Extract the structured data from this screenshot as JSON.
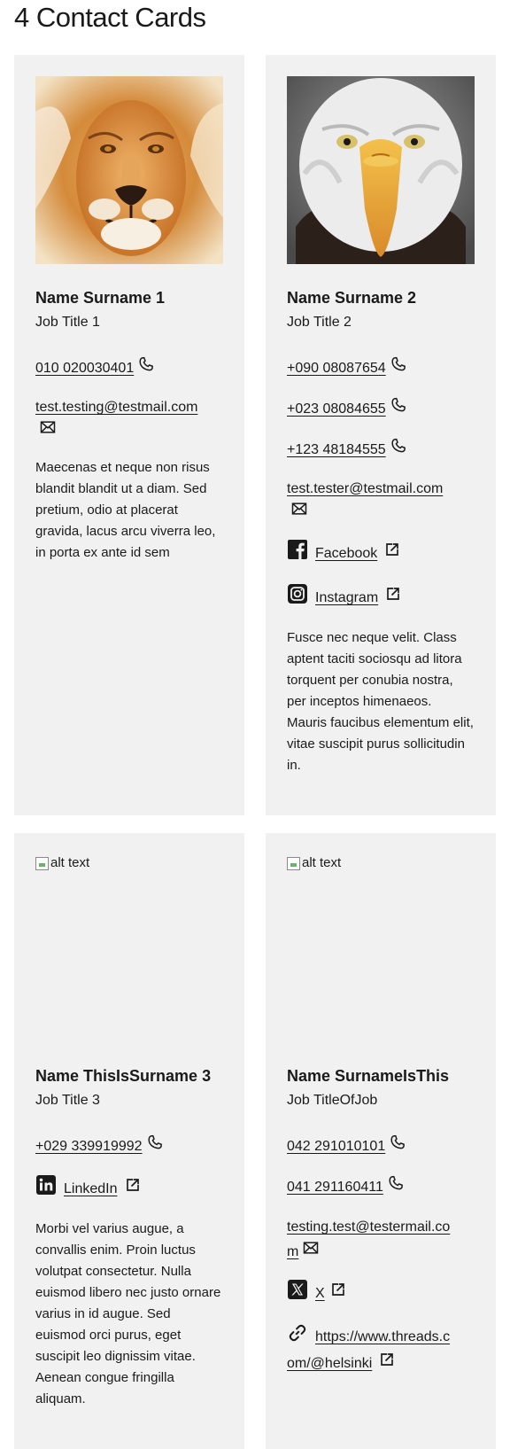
{
  "page": {
    "title": "4 Contact Cards"
  },
  "cards": [
    {
      "image": {
        "kind": "lion",
        "alt": ""
      },
      "name": "Name Surname 1",
      "job": "Job Title 1",
      "phones": [
        "010 020030401"
      ],
      "email": [
        "test.testing@testmail.com"
      ],
      "description": "Maecenas et neque non risus blandit blandit ut a diam. Sed pretium, odio at placerat gravida, lacus arcu viverra leo, in porta ex ante id sem"
    },
    {
      "image": {
        "kind": "eagle",
        "alt": ""
      },
      "name": "Name Surname 2",
      "job": "Job Title 2",
      "phones": [
        "+090 08087654",
        "+023 08084655",
        "+123 48184555"
      ],
      "email": [
        "test.tester@testmail.com"
      ],
      "social": [
        {
          "icon": "facebook-icon",
          "label": "Facebook"
        },
        {
          "icon": "instagram-icon",
          "label": "Instagram"
        }
      ],
      "description": "Fusce nec neque velit. Class aptent taciti sociosqu ad litora torquent per conubia nostra, per inceptos himenaeos. Mauris faucibus elementum elit, vitae suscipit purus sollicitudin in."
    },
    {
      "image": {
        "kind": "broken",
        "alt": "alt text"
      },
      "name": "Name ThisIsSurname 3",
      "job": "Job Title 3",
      "phones": [
        "+029 339919992"
      ],
      "social": [
        {
          "icon": "linkedin-icon",
          "label": "LinkedIn"
        }
      ],
      "description": "Morbi vel varius augue, a convallis enim. Proin luctus volutpat consectetur. Nulla euismod libero nec justo ornare varius in id augue. Sed euismod orci purus, eget suscipit leo dignissim vitae. Aenean congue fringilla aliquam."
    },
    {
      "image": {
        "kind": "broken",
        "alt": "alt text"
      },
      "name": "Name SurnameIsThis",
      "job": "Job TitleOfJob",
      "phones": [
        "042 291010101",
        "041 291160411"
      ],
      "email": [
        "testing.test@testermail.co",
        "m"
      ],
      "social": [
        {
          "icon": "x-icon",
          "label": "X"
        },
        {
          "icon": "link-icon",
          "label": [
            "https://www.threads.c",
            "om/@helsinki"
          ]
        }
      ]
    }
  ]
}
